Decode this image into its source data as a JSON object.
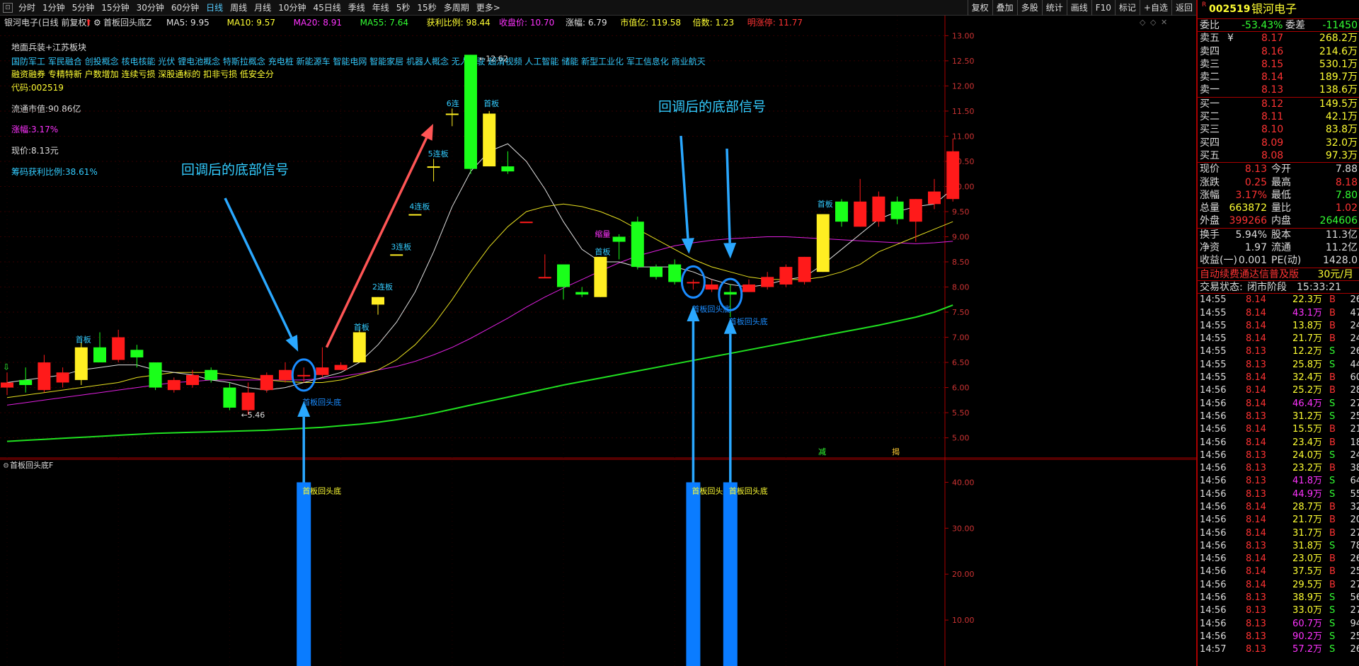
{
  "toolbar": {
    "periods": [
      "分时",
      "1分钟",
      "5分钟",
      "15分钟",
      "30分钟",
      "60分钟",
      "日线",
      "周线",
      "月线",
      "10分钟",
      "45日线",
      "季线",
      "年线",
      "5秒",
      "15秒",
      "多周期",
      "更多>"
    ],
    "active_period": "日线",
    "right_buttons": [
      "复权",
      "叠加",
      "多股",
      "统计",
      "画线",
      "F10",
      "标记",
      "+自选",
      "返回"
    ]
  },
  "chart": {
    "title_bar": {
      "stock": "银河电子(日线 前复权)",
      "indicator": "首板回头底Z",
      "items": [
        {
          "text": "MA5: 9.95",
          "color": "#e0e0e0"
        },
        {
          "text": "MA10: 9.57",
          "color": "#ffff33"
        },
        {
          "text": "MA20: 8.91",
          "color": "#ff33ff"
        },
        {
          "text": "MA55: 7.64",
          "color": "#33ff33"
        },
        {
          "text": "获利比例: 98.44",
          "color": "#ffff33"
        },
        {
          "text": "收盘价: 10.70",
          "color": "#ff33ff"
        },
        {
          "text": "涨幅: 6.79",
          "color": "#e0e0e0"
        },
        {
          "text": "市值亿: 119.58",
          "color": "#ffff33"
        },
        {
          "text": "倍数: 1.23",
          "color": "#ffff33"
        },
        {
          "text": "明涨停: 11.77",
          "color": "#ff3333"
        }
      ]
    },
    "info": {
      "line1": "地面兵装+江苏板块",
      "line2": "国防军工 军民融合 创投概念 核电核能 光伏 锂电池概念 特斯拉概念 充电桩 新能源车 智能电网 智能家居 机器人概念 无人驾驶 超清视频 人工智能 储能 新型工业化 军工信息化 商业航天",
      "line3": "融资融券 专精特新 户数增加 连续亏损 深股通标的 扣非亏损 低安全分",
      "code": "代码:002519",
      "float_cap": "流通市值:90.86亿",
      "change": "涨幅:3.17%",
      "price": "现价:8.13元",
      "chip": "筹码获利比例:38.61%"
    },
    "annotations": {
      "signal_left": "回调后的底部信号",
      "signal_right": "回调后的底部信号",
      "candle_labels": [
        "首板",
        "首板",
        "2连板",
        "3连板",
        "4连板",
        "5连板",
        "6连",
        "首板",
        "缩量",
        "首板",
        "首板"
      ],
      "max_label": "12.62",
      "min_label": "5.46",
      "bottom_label": "首板回头底",
      "small_marks": [
        "减",
        "揭"
      ]
    },
    "price_axis": {
      "min": 4.6,
      "max": 13.4,
      "ticks": [
        "13.00",
        "12.50",
        "12.00",
        "11.50",
        "11.00",
        "10.50",
        "10.00",
        "9.50",
        "9.00",
        "8.50",
        "8.00",
        "7.50",
        "7.00",
        "6.50",
        "6.00",
        "5.50",
        "5.00"
      ]
    },
    "sub_panel": {
      "title": "首板回头底F",
      "axis_ticks": [
        "40.00",
        "30.00",
        "20.00",
        "10.00"
      ],
      "bar_label": "首板回头底"
    },
    "colors": {
      "up": "#ff1a1a",
      "down": "#1aff1a",
      "limit": "#ffee22",
      "signal": "#1a8cff",
      "ma5": "#e0e0e0",
      "ma10": "#e8e020",
      "ma20": "#e020e0",
      "ma55": "#20e020"
    }
  },
  "chart_data": {
    "type": "candlestick",
    "candles": [
      {
        "o": 6.0,
        "c": 6.1,
        "h": 6.3,
        "l": 5.85
      },
      {
        "o": 6.15,
        "c": 6.05,
        "h": 6.4,
        "l": 5.9
      },
      {
        "o": 5.95,
        "c": 6.5,
        "h": 6.65,
        "l": 5.9
      },
      {
        "o": 6.1,
        "c": 6.3,
        "h": 6.4,
        "l": 6.0
      },
      {
        "o": 6.15,
        "c": 6.8,
        "h": 6.9,
        "l": 6.05
      },
      {
        "o": 6.8,
        "c": 6.5,
        "h": 7.1,
        "l": 6.5
      },
      {
        "o": 6.55,
        "c": 7.0,
        "h": 7.15,
        "l": 6.5
      },
      {
        "o": 6.75,
        "c": 6.6,
        "h": 6.85,
        "l": 6.4
      },
      {
        "o": 6.5,
        "c": 6.0,
        "h": 6.5,
        "l": 5.95
      },
      {
        "o": 5.95,
        "c": 6.15,
        "h": 6.2,
        "l": 5.9
      },
      {
        "o": 6.05,
        "c": 6.25,
        "h": 6.35,
        "l": 6.0
      },
      {
        "o": 6.35,
        "c": 6.15,
        "h": 6.4,
        "l": 6.1
      },
      {
        "o": 6.0,
        "c": 5.6,
        "h": 6.1,
        "l": 5.55
      },
      {
        "o": 5.55,
        "c": 5.9,
        "h": 6.1,
        "l": 5.46
      },
      {
        "o": 5.95,
        "c": 6.25,
        "h": 6.3,
        "l": 5.9
      },
      {
        "o": 6.15,
        "c": 6.35,
        "h": 6.5,
        "l": 6.1
      },
      {
        "o": 6.25,
        "c": 6.25,
        "h": 6.4,
        "l": 6.1
      },
      {
        "o": 6.25,
        "c": 6.4,
        "h": 6.8,
        "l": 6.2
      },
      {
        "o": 6.35,
        "c": 6.45,
        "h": 6.5,
        "l": 6.35
      },
      {
        "o": 6.5,
        "c": 7.1,
        "h": 7.15,
        "l": 6.5
      },
      {
        "o": 7.65,
        "c": 7.8,
        "h": 7.8,
        "l": 7.45
      },
      {
        "o": 8.65,
        "c": 8.65,
        "h": 8.65,
        "l": 8.65
      },
      {
        "o": 9.45,
        "c": 9.45,
        "h": 9.45,
        "l": 9.45
      },
      {
        "o": 10.4,
        "c": 10.4,
        "h": 10.55,
        "l": 10.1
      },
      {
        "o": 11.45,
        "c": 11.45,
        "h": 11.55,
        "l": 11.2
      },
      {
        "o": 12.62,
        "c": 10.35,
        "h": 12.62,
        "l": 10.25
      },
      {
        "o": 10.4,
        "c": 11.45,
        "h": 11.5,
        "l": 10.4
      },
      {
        "o": 10.4,
        "c": 10.3,
        "h": 10.7,
        "l": 10.25
      },
      {
        "o": 9.3,
        "c": 9.3,
        "h": 9.3,
        "l": 9.3
      },
      {
        "o": 8.2,
        "c": 8.2,
        "h": 8.65,
        "l": 8.2
      },
      {
        "o": 8.45,
        "c": 8.0,
        "h": 8.45,
        "l": 7.75
      },
      {
        "o": 7.9,
        "c": 7.85,
        "h": 8.0,
        "l": 7.8
      },
      {
        "o": 7.8,
        "c": 8.6,
        "h": 8.6,
        "l": 7.8
      },
      {
        "o": 9.0,
        "c": 8.9,
        "h": 9.05,
        "l": 8.55
      },
      {
        "o": 9.3,
        "c": 8.4,
        "h": 9.4,
        "l": 8.35
      },
      {
        "o": 8.4,
        "c": 8.2,
        "h": 8.45,
        "l": 8.15
      },
      {
        "o": 8.45,
        "c": 8.1,
        "h": 8.55,
        "l": 8.05
      },
      {
        "o": 8.1,
        "c": 8.1,
        "h": 8.15,
        "l": 7.95
      },
      {
        "o": 7.95,
        "c": 8.05,
        "h": 8.15,
        "l": 7.9
      },
      {
        "o": 7.9,
        "c": 7.85,
        "h": 8.05,
        "l": 7.4
      },
      {
        "o": 7.9,
        "c": 8.05,
        "h": 8.15,
        "l": 7.9
      },
      {
        "o": 8.0,
        "c": 8.2,
        "h": 8.3,
        "l": 7.95
      },
      {
        "o": 8.05,
        "c": 8.4,
        "h": 8.45,
        "l": 8.0
      },
      {
        "o": 8.1,
        "c": 8.6,
        "h": 8.6,
        "l": 8.05
      },
      {
        "o": 8.3,
        "c": 9.45,
        "h": 9.45,
        "l": 8.3
      },
      {
        "o": 9.7,
        "c": 9.3,
        "h": 9.75,
        "l": 9.2
      },
      {
        "o": 9.2,
        "c": 9.7,
        "h": 10.15,
        "l": 9.2
      },
      {
        "o": 9.3,
        "c": 9.8,
        "h": 9.9,
        "l": 9.2
      },
      {
        "o": 9.7,
        "c": 9.35,
        "h": 9.8,
        "l": 9.25
      },
      {
        "o": 9.3,
        "c": 9.75,
        "h": 9.75,
        "l": 8.9
      },
      {
        "o": 9.65,
        "c": 9.9,
        "h": 10.15,
        "l": 9.55
      },
      {
        "o": 9.75,
        "c": 10.7,
        "h": 10.95,
        "l": 9.7
      }
    ],
    "limit_up_days": [
      4,
      19,
      20,
      21,
      22,
      23,
      24,
      26,
      32,
      44
    ],
    "signal_days": [
      16,
      37,
      39
    ],
    "ma5": [
      6.1,
      6.15,
      6.2,
      6.25,
      6.35,
      6.4,
      6.45,
      6.45,
      6.35,
      6.3,
      6.25,
      6.15,
      6.1,
      6.0,
      5.95,
      6.0,
      6.1,
      6.2,
      6.3,
      6.5,
      6.85,
      7.3,
      7.9,
      8.7,
      9.6,
      10.3,
      10.7,
      10.85,
      10.5,
      9.95,
      9.3,
      8.75,
      8.5,
      8.5,
      8.4,
      8.4,
      8.4,
      8.3,
      8.15,
      8.05,
      8.0,
      8.05,
      8.15,
      8.2,
      8.45,
      8.75,
      9.05,
      9.35,
      9.5,
      9.6,
      9.65,
      9.95
    ],
    "ma10": [
      5.8,
      5.85,
      5.9,
      5.95,
      6.0,
      6.05,
      6.1,
      6.2,
      6.25,
      6.3,
      6.3,
      6.3,
      6.25,
      6.2,
      6.15,
      6.12,
      6.1,
      6.1,
      6.15,
      6.25,
      6.35,
      6.55,
      6.85,
      7.25,
      7.75,
      8.3,
      8.8,
      9.2,
      9.5,
      9.6,
      9.65,
      9.6,
      9.5,
      9.35,
      9.15,
      8.95,
      8.75,
      8.55,
      8.4,
      8.3,
      8.2,
      8.15,
      8.15,
      8.15,
      8.2,
      8.3,
      8.45,
      8.7,
      8.85,
      9.0,
      9.15,
      9.3
    ],
    "ma20": [
      5.65,
      5.7,
      5.75,
      5.8,
      5.85,
      5.9,
      5.95,
      6.0,
      6.05,
      6.1,
      6.12,
      6.15,
      6.15,
      6.15,
      6.15,
      6.15,
      6.15,
      6.18,
      6.22,
      6.28,
      6.35,
      6.42,
      6.52,
      6.65,
      6.8,
      6.98,
      7.18,
      7.38,
      7.6,
      7.8,
      7.98,
      8.15,
      8.32,
      8.48,
      8.62,
      8.72,
      8.82,
      8.88,
      8.93,
      8.96,
      8.98,
      9.0,
      9.0,
      8.98,
      8.96,
      8.94,
      8.92,
      8.9,
      8.88,
      8.86,
      8.88,
      8.91
    ],
    "ma55": [
      4.93,
      4.95,
      4.97,
      4.99,
      5.01,
      5.03,
      5.05,
      5.07,
      5.09,
      5.1,
      5.11,
      5.12,
      5.13,
      5.14,
      5.15,
      5.17,
      5.19,
      5.21,
      5.24,
      5.27,
      5.31,
      5.36,
      5.42,
      5.49,
      5.57,
      5.65,
      5.73,
      5.81,
      5.89,
      5.97,
      6.05,
      6.12,
      6.19,
      6.26,
      6.33,
      6.4,
      6.47,
      6.54,
      6.61,
      6.68,
      6.75,
      6.82,
      6.89,
      6.96,
      7.03,
      7.1,
      7.17,
      7.24,
      7.32,
      7.4,
      7.5,
      7.64
    ],
    "sub_bars": [
      {
        "day": 16,
        "value": 40
      },
      {
        "day": 37,
        "value": 40
      },
      {
        "day": 39,
        "value": 40
      }
    ]
  },
  "right_panel": {
    "code_small": "R",
    "code": "002519",
    "name": "银河电子",
    "weibi_label": "委比",
    "weibi": "-53.43%",
    "weicha_label": "委差",
    "weicha": "-11450",
    "asks": [
      {
        "label": "卖五",
        "mark": "¥",
        "price": "8.17",
        "vol": "268.2万"
      },
      {
        "label": "卖四",
        "price": "8.16",
        "vol": "214.6万"
      },
      {
        "label": "卖三",
        "price": "8.15",
        "vol": "530.1万"
      },
      {
        "label": "卖二",
        "price": "8.14",
        "vol": "189.7万"
      },
      {
        "label": "卖一",
        "price": "8.13",
        "vol": "138.6万"
      }
    ],
    "bids": [
      {
        "label": "买一",
        "price": "8.12",
        "vol": "149.5万"
      },
      {
        "label": "买二",
        "price": "8.11",
        "vol": "42.1万"
      },
      {
        "label": "买三",
        "price": "8.10",
        "vol": "83.8万"
      },
      {
        "label": "买四",
        "price": "8.09",
        "vol": "32.0万"
      },
      {
        "label": "买五",
        "price": "8.08",
        "vol": "97.3万"
      }
    ],
    "quote": [
      {
        "l1": "现价",
        "v1": "8.13",
        "c1": "#ff3333",
        "l2": "今开",
        "v2": "7.88",
        "c2": "#dddddd"
      },
      {
        "l1": "涨跌",
        "v1": "0.25",
        "c1": "#ff3333",
        "l2": "最高",
        "v2": "8.18",
        "c2": "#ff3333"
      },
      {
        "l1": "涨幅",
        "v1": "3.17%",
        "c1": "#ff3333",
        "l2": "最低",
        "v2": "7.80",
        "c2": "#33ff33"
      },
      {
        "l1": "总量",
        "v1": "663872",
        "c1": "#ffff33",
        "l2": "量比",
        "v2": "1.02",
        "c2": "#ff3333"
      },
      {
        "l1": "外盘",
        "v1": "399266",
        "c1": "#ff3333",
        "l2": "内盘",
        "v2": "264606",
        "c2": "#33ff33"
      }
    ],
    "quote2": [
      {
        "l1": "换手",
        "v1": "5.94%",
        "l2": "股本",
        "v2": "11.3亿"
      },
      {
        "l1": "净资",
        "v1": "1.97",
        "l2": "流通",
        "v2": "11.2亿"
      },
      {
        "l1": "收益(一)",
        "v1": "0.001",
        "l2": "PE(动)",
        "v2": "1428.0"
      }
    ],
    "ad_text": "自动续费通达信普及版",
    "ad_price": "30元/月",
    "status_label": "交易状态:",
    "status": "闭市阶段",
    "status_time": "15:33:21",
    "ticks": [
      {
        "t": "14:55",
        "p": "8.14",
        "v": "22.3万",
        "d": "B",
        "n": "26"
      },
      {
        "t": "14:55",
        "p": "8.14",
        "v": "43.1万",
        "d": "B",
        "n": "47"
      },
      {
        "t": "14:55",
        "p": "8.14",
        "v": "13.8万",
        "d": "B",
        "n": "24"
      },
      {
        "t": "14:55",
        "p": "8.14",
        "v": "21.7万",
        "d": "B",
        "n": "24"
      },
      {
        "t": "14:55",
        "p": "8.13",
        "v": "12.2万",
        "d": "S",
        "n": "26"
      },
      {
        "t": "14:55",
        "p": "8.13",
        "v": "25.8万",
        "d": "S",
        "n": "44"
      },
      {
        "t": "14:55",
        "p": "8.14",
        "v": "32.4万",
        "d": "B",
        "n": "60"
      },
      {
        "t": "14:56",
        "p": "8.14",
        "v": "25.2万",
        "d": "B",
        "n": "28"
      },
      {
        "t": "14:56",
        "p": "8.14",
        "v": "46.4万",
        "d": "S",
        "n": "27"
      },
      {
        "t": "14:56",
        "p": "8.13",
        "v": "31.2万",
        "d": "S",
        "n": "25"
      },
      {
        "t": "14:56",
        "p": "8.14",
        "v": "15.5万",
        "d": "B",
        "n": "21"
      },
      {
        "t": "14:56",
        "p": "8.14",
        "v": "23.4万",
        "d": "B",
        "n": "18"
      },
      {
        "t": "14:56",
        "p": "8.13",
        "v": "24.0万",
        "d": "S",
        "n": "24"
      },
      {
        "t": "14:56",
        "p": "8.13",
        "v": "23.2万",
        "d": "B",
        "n": "38"
      },
      {
        "t": "14:56",
        "p": "8.13",
        "v": "41.8万",
        "d": "S",
        "n": "64"
      },
      {
        "t": "14:56",
        "p": "8.13",
        "v": "44.9万",
        "d": "S",
        "n": "55"
      },
      {
        "t": "14:56",
        "p": "8.14",
        "v": "28.7万",
        "d": "B",
        "n": "32"
      },
      {
        "t": "14:56",
        "p": "8.14",
        "v": "21.7万",
        "d": "B",
        "n": "20"
      },
      {
        "t": "14:56",
        "p": "8.14",
        "v": "31.7万",
        "d": "B",
        "n": "27"
      },
      {
        "t": "14:56",
        "p": "8.13",
        "v": "31.8万",
        "d": "S",
        "n": "78"
      },
      {
        "t": "14:56",
        "p": "8.14",
        "v": "23.0万",
        "d": "B",
        "n": "26"
      },
      {
        "t": "14:56",
        "p": "8.14",
        "v": "37.5万",
        "d": "B",
        "n": "25"
      },
      {
        "t": "14:56",
        "p": "8.14",
        "v": "29.5万",
        "d": "B",
        "n": "27"
      },
      {
        "t": "14:56",
        "p": "8.13",
        "v": "38.9万",
        "d": "S",
        "n": "56"
      },
      {
        "t": "14:56",
        "p": "8.13",
        "v": "33.0万",
        "d": "S",
        "n": "27"
      },
      {
        "t": "14:56",
        "p": "8.13",
        "v": "60.7万",
        "d": "S",
        "n": "94"
      },
      {
        "t": "14:56",
        "p": "8.13",
        "v": "90.2万",
        "d": "S",
        "n": "25"
      },
      {
        "t": "14:57",
        "p": "8.13",
        "v": "57.2万",
        "d": "S",
        "n": "26"
      }
    ]
  }
}
